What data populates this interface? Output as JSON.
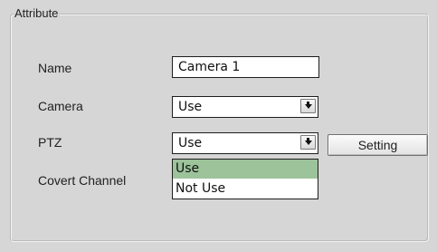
{
  "group": {
    "title": "Attribute"
  },
  "fields": {
    "name": {
      "label": "Name",
      "value": "Camera 1"
    },
    "camera": {
      "label": "Camera",
      "value": "Use",
      "icon": "dropdown-arrow-icon"
    },
    "ptz": {
      "label": "PTZ",
      "value": "Use",
      "icon": "dropdown-arrow-icon",
      "setting_label": "Setting",
      "options": [
        "Use",
        "Not Use"
      ],
      "highlighted_option": "Use"
    },
    "covert_channel": {
      "label": "Covert Channel"
    }
  },
  "colors": {
    "panel_bg": "#d6d6d6",
    "selected_option_bg": "#9cc39a",
    "field_bg": "#ffffff",
    "text": "#111111"
  }
}
